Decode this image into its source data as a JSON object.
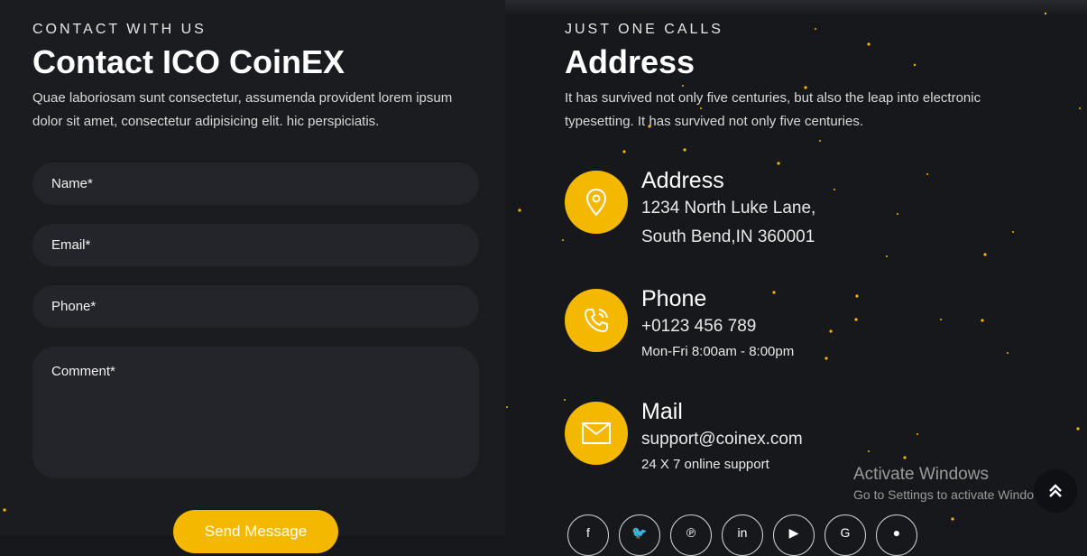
{
  "contact_form": {
    "eyebrow": "CONTACT WITH US",
    "title": "Contact ICO CoinEX",
    "description": "Quae laboriosam sunt consectetur, assumenda provident lorem ipsum dolor sit amet, consectetur adipisicing elit. hic perspiciatis.",
    "name_placeholder": "Name*",
    "email_placeholder": "Email*",
    "phone_placeholder": "Phone*",
    "comment_placeholder": "Comment*",
    "send_label": "Send Message"
  },
  "address_section": {
    "eyebrow": "JUST ONE CALLS",
    "title": "Address",
    "description": "It has survived not only five centuries, but also the leap into electronic typesetting. It has survived not only five centuries.",
    "items": [
      {
        "title": "Address",
        "line1": "1234 North Luke Lane,",
        "line2": "South Bend,IN 360001",
        "icon": "map-pin-icon"
      },
      {
        "title": "Phone",
        "line1": "+0123 456 789",
        "line2": "Mon-Fri 8:00am - 8:00pm",
        "icon": "phone-icon"
      },
      {
        "title": "Mail",
        "line1": "support@coinex.com",
        "line2": "24 X 7 online support",
        "icon": "mail-icon"
      }
    ]
  },
  "social": [
    {
      "name": "facebook-icon",
      "glyph": "f"
    },
    {
      "name": "twitter-icon",
      "glyph": "🐦"
    },
    {
      "name": "pinterest-icon",
      "glyph": "℗"
    },
    {
      "name": "linkedin-icon",
      "glyph": "in"
    },
    {
      "name": "youtube-icon",
      "glyph": "▶"
    },
    {
      "name": "google-icon",
      "glyph": "G"
    },
    {
      "name": "other-social-icon",
      "glyph": "●"
    }
  ],
  "windows_activation": {
    "title": "Activate Windows",
    "subtitle": "Go to Settings to activate Windows."
  },
  "colors": {
    "accent": "#f5b800",
    "background": "#17181c",
    "panel": "#1b1c20",
    "field": "#24252a"
  }
}
